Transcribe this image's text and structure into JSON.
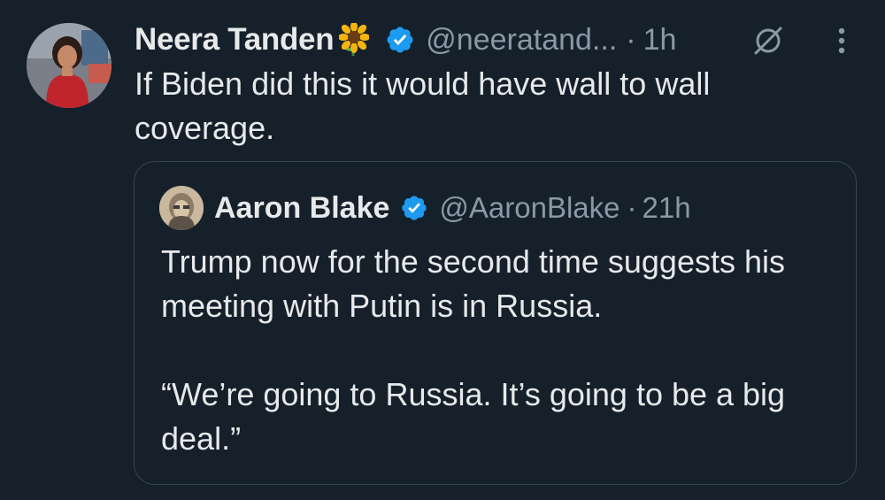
{
  "tweet": {
    "author_name": "Neera Tanden",
    "author_emoji": "🌻",
    "author_handle": "@neeratand...",
    "separator": "·",
    "time": "1h",
    "text": "If Biden did this it would have wall to wall coverage.",
    "icons": {
      "verified": "verified-badge-icon",
      "grok": "grok-icon",
      "more": "more-options-icon"
    }
  },
  "quoted_tweet": {
    "author_name": "Aaron Blake",
    "author_handle": "@AaronBlake",
    "separator": "·",
    "time": "21h",
    "paragraphs": [
      "Trump now for the second time suggests his meeting with Putin is in Russia.",
      "“We’re going to Russia. It’s going to be a big deal.”"
    ]
  },
  "colors": {
    "background": "#15202b",
    "primary_text": "#e7e9ea",
    "secondary_text": "#8b98a5",
    "verified_blue": "#1d9bf0",
    "border": "#38444d"
  }
}
